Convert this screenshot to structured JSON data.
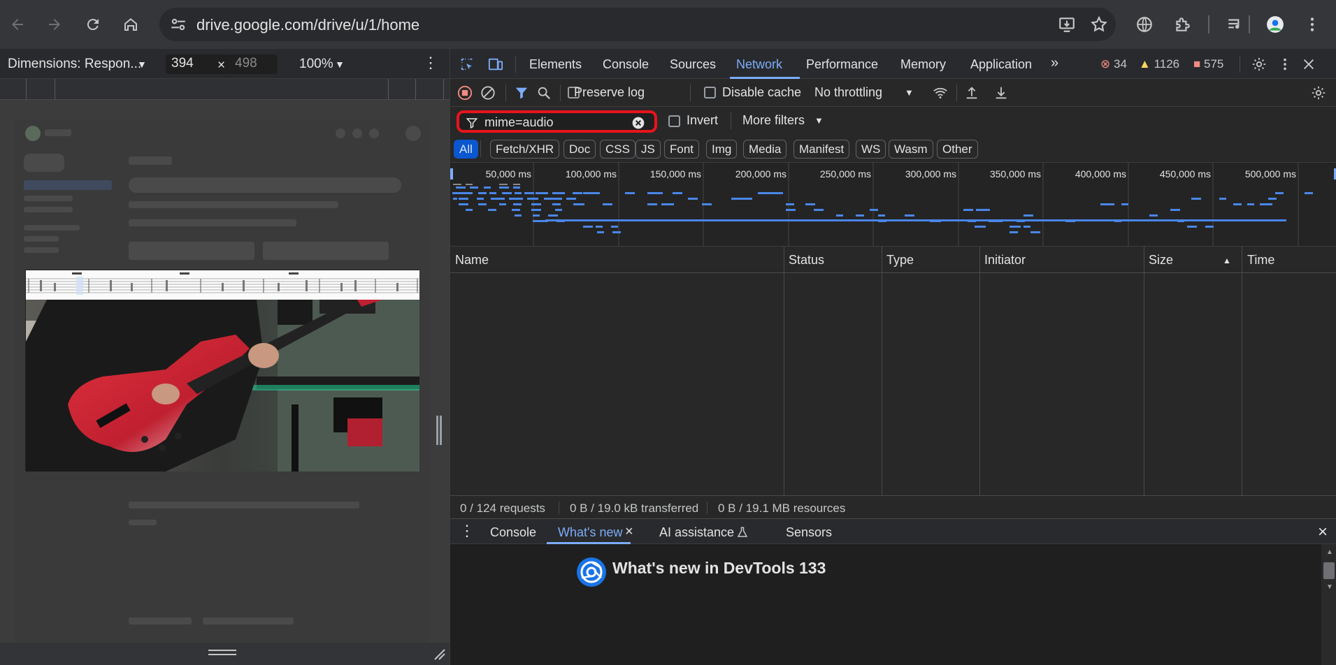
{
  "browser": {
    "url": "drive.google.com/drive/u/1/home"
  },
  "device_toolbar": {
    "dimensions_label": "Dimensions: Respon...",
    "width": "394",
    "height": "498",
    "zoom": "100%"
  },
  "devtools": {
    "tabs": [
      "Elements",
      "Console",
      "Sources",
      "Network",
      "Performance",
      "Memory",
      "Application"
    ],
    "active_tab": "Network",
    "errors": "34",
    "warnings": "1126",
    "issues": "575"
  },
  "network_toolbar": {
    "preserve_log": "Preserve log",
    "disable_cache": "Disable cache",
    "throttling": "No throttling"
  },
  "filter": {
    "value": "mime=audio",
    "invert": "Invert",
    "more_filters": "More filters"
  },
  "type_filters": [
    "All",
    "Fetch/XHR",
    "Doc",
    "CSS",
    "JS",
    "Font",
    "Img",
    "Media",
    "Manifest",
    "WS",
    "Wasm",
    "Other"
  ],
  "timeline_ticks": [
    "50,000 ms",
    "100,000 ms",
    "150,000 ms",
    "200,000 ms",
    "250,000 ms",
    "300,000 ms",
    "350,000 ms",
    "400,000 ms",
    "450,000 ms",
    "500,000 ms"
  ],
  "columns": [
    "Name",
    "Status",
    "Type",
    "Initiator",
    "Size",
    "Time"
  ],
  "status": {
    "requests": "0 / 124 requests",
    "transferred": "0 B / 19.0 kB transferred",
    "resources": "0 B / 19.1 MB resources"
  },
  "drawer": {
    "tabs": [
      "Console",
      "What's new",
      "AI assistance",
      "Sensors"
    ],
    "active_tab": "What's new",
    "whats_new_title": "What's new in DevTools 133"
  },
  "colors": {
    "accent": "#7cacf8",
    "highlight_border": "#e8141c",
    "timeline_bar": "#4a86e8",
    "error": "#f28b82",
    "warning": "#fdd663"
  }
}
